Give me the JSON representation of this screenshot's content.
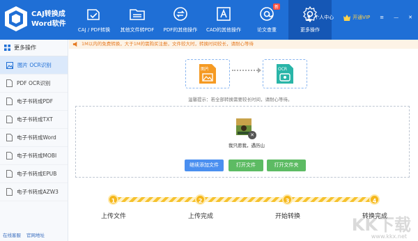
{
  "app": {
    "name_line1": "CAJ转换成",
    "name_line2": "Word软件"
  },
  "nav": [
    {
      "label": "CAJ / PDF转换",
      "icon": "caj-pdf-convert-icon"
    },
    {
      "label": "其他文件转PDF",
      "icon": "folder-icon"
    },
    {
      "label": "PDF的其他操作",
      "icon": "refresh-icon"
    },
    {
      "label": "CAD的其他操作",
      "icon": "cad-icon"
    },
    {
      "label": "论文查重",
      "icon": "search-at-icon",
      "badge": "新"
    },
    {
      "label": "更多操作",
      "icon": "gear-icon"
    }
  ],
  "topright": {
    "user": "个人中心",
    "vip": "开通VIP"
  },
  "sidebar": {
    "head": "更多操作",
    "items": [
      "图片 OCR识别",
      "PDF OCR识别",
      "电子书转成PDF",
      "电子书转成TXT",
      "电子书转成Word",
      "电子书转成MOBI",
      "电子书转成EPUB",
      "电子书转成AZW3"
    ],
    "footer": [
      "在线客服",
      "官网地址"
    ]
  },
  "notice": "1M以内的免费转换，大于1M的需购买注册，文件较大时，转换时间较长，请耐心等待",
  "flow": {
    "from": "图片",
    "to": "OCR"
  },
  "hint": "温馨提示：若全部转换需要较长时间，请耐心等待。",
  "file": {
    "name": "我只愿我，遇历山"
  },
  "buttons": {
    "add": "继续添加文件",
    "open_file": "打开文件",
    "open_folder": "打开文件夹"
  },
  "steps": [
    {
      "num": "1",
      "label": "上传文件"
    },
    {
      "num": "2",
      "label": "上传完成"
    },
    {
      "num": "3",
      "label": "开始转换"
    },
    {
      "num": "4",
      "label": "转换完成"
    }
  ],
  "watermark": {
    "text": "KK下载",
    "sub": "www.kkx.net"
  },
  "colors": {
    "primary": "#1f6fd6",
    "accent": "#f5b71c",
    "notice": "#e57b22",
    "green": "#5dbb63"
  }
}
